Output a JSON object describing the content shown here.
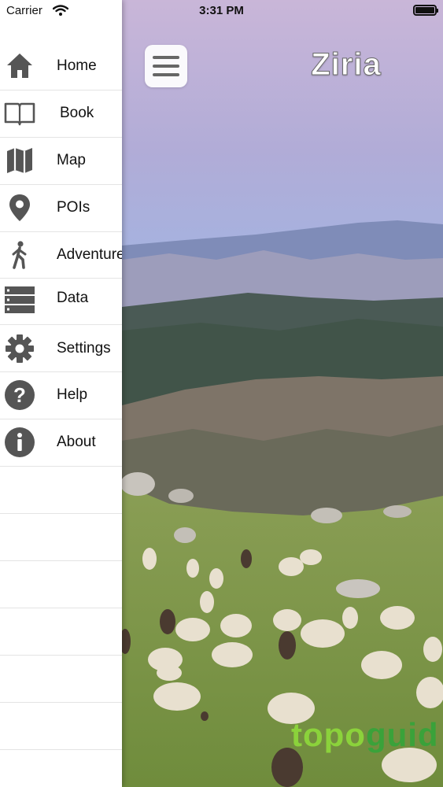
{
  "status_bar": {
    "carrier": "Carrier",
    "time": "3:31 PM"
  },
  "header": {
    "title": "Ziria"
  },
  "watermark": {
    "part1": "topo",
    "part2": "guid"
  },
  "sidebar": {
    "items": [
      {
        "label": "Home",
        "icon": "home-icon"
      },
      {
        "label": "Book",
        "icon": "book-icon"
      },
      {
        "label": "Map",
        "icon": "map-icon"
      },
      {
        "label": "POIs",
        "icon": "location-pin-icon"
      },
      {
        "label": "Adventures",
        "icon": "hiker-icon"
      },
      {
        "label": "Data",
        "icon": "data-list-icon"
      },
      {
        "label": "Settings",
        "icon": "gear-icon"
      },
      {
        "label": "Help",
        "icon": "help-icon"
      },
      {
        "label": "About",
        "icon": "info-icon"
      }
    ]
  },
  "colors": {
    "icon_gray": "#555555",
    "watermark_light": "#8bd23b",
    "watermark_dark": "#3aa23a"
  }
}
